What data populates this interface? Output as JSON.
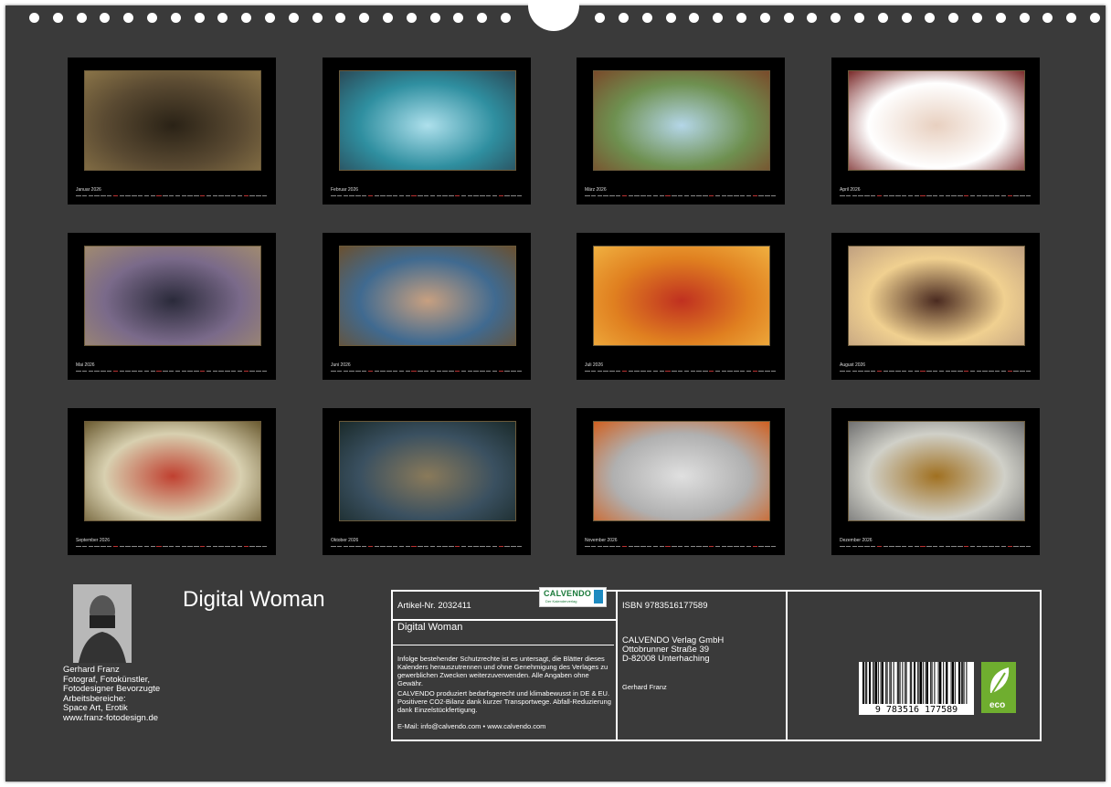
{
  "months": [
    {
      "name": "Januar",
      "year": "2026"
    },
    {
      "name": "Februar",
      "year": "2026"
    },
    {
      "name": "März",
      "year": "2026"
    },
    {
      "name": "April",
      "year": "2026"
    },
    {
      "name": "Mai",
      "year": "2026"
    },
    {
      "name": "Juni",
      "year": "2026"
    },
    {
      "name": "Juli",
      "year": "2026"
    },
    {
      "name": "August",
      "year": "2026"
    },
    {
      "name": "September",
      "year": "2026"
    },
    {
      "name": "Oktober",
      "year": "2026"
    },
    {
      "name": "November",
      "year": "2026"
    },
    {
      "name": "Dezember",
      "year": "2026"
    }
  ],
  "author": {
    "name": "Gerhard Franz",
    "lines": [
      "Fotograf, Fotokünstler,",
      "Fotodesigner Bevorzugte",
      "Arbeitsbereiche:",
      "Space Art, Erotik",
      "www.franz-fotodesign.de"
    ]
  },
  "title": "Digital Woman",
  "info": {
    "article": "Artikel-Nr. 2032411",
    "title": "Digital Woman",
    "notice": "Infolge bestehender Schutzrechte ist es untersagt, die Blätter dieses Kalenders herauszutrennen und ohne Genehmigung des Verlages zu gewerblichen Zwecken weiterzuverwenden. Alle Angaben ohne Gewähr.",
    "eco_text": "CALVENDO produziert bedarfsgerecht und klimabewusst in DE & EU. Positivere CO2-Bilanz dank kurzer Transportwege. Abfall-Reduzierung dank Einzelstückfertigung.",
    "contact": "E-Mail: info@calvendo.com • www.calvendo.com",
    "isbn": "ISBN 9783516177589",
    "publisher": [
      "CALVENDO Verlag GmbH",
      "Ottobrunner Straße 39",
      "D-82008 Unterhaching"
    ],
    "author_name": "Gerhard Franz",
    "logo": "CALVENDO",
    "logo_sub": "Der Kalenderverlag",
    "barcode_digits": "9 783516 177589",
    "eco_label": "eco"
  },
  "colors": {
    "background": "#3a3a3a",
    "tile": "#000000",
    "accent_red": "#b33333",
    "eco_green": "#6fae2f"
  }
}
